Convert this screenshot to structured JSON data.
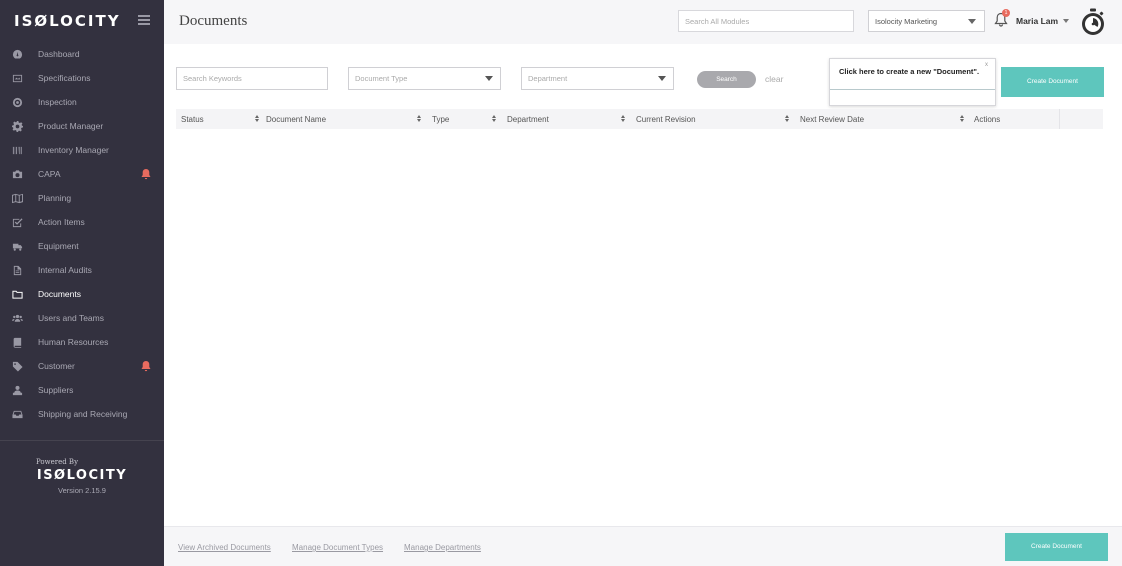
{
  "sidebar": {
    "logo_text": "ISØLOCITY",
    "items": [
      {
        "label": "Dashboard",
        "icon": "dashboard-icon"
      },
      {
        "label": "Specifications",
        "icon": "specifications-icon"
      },
      {
        "label": "Inspection",
        "icon": "inspection-icon"
      },
      {
        "label": "Product Manager",
        "icon": "gear-icon"
      },
      {
        "label": "Inventory Manager",
        "icon": "barcode-icon"
      },
      {
        "label": "CAPA",
        "icon": "camera-icon",
        "alert": true
      },
      {
        "label": "Planning",
        "icon": "map-icon"
      },
      {
        "label": "Action Items",
        "icon": "checkbox-icon"
      },
      {
        "label": "Equipment",
        "icon": "truck-icon"
      },
      {
        "label": "Internal Audits",
        "icon": "document-icon"
      },
      {
        "label": "Documents",
        "icon": "folder-icon",
        "active": true
      },
      {
        "label": "Users and Teams",
        "icon": "users-icon"
      },
      {
        "label": "Human Resources",
        "icon": "book-icon"
      },
      {
        "label": "Customer",
        "icon": "tag-icon",
        "alert": true
      },
      {
        "label": "Suppliers",
        "icon": "supplier-icon"
      },
      {
        "label": "Shipping and Receiving",
        "icon": "inbox-icon"
      }
    ],
    "powered_by": "Powered By",
    "brand": "ISØLOCITY",
    "version": "Version 2.15.9"
  },
  "header": {
    "title": "Documents",
    "global_search_placeholder": "Search All Modules",
    "company": "Isolocity Marketing",
    "notification_count": "1",
    "user_name": "Maria Lam"
  },
  "filters": {
    "keywords_placeholder": "Search Keywords",
    "document_type_placeholder": "Document Type",
    "department_placeholder": "Department",
    "search_label": "Search",
    "clear_label": "clear"
  },
  "tooltip": {
    "text": "Click here to create a new \"Document\".",
    "close": "x"
  },
  "create_label": "Create Document",
  "table": {
    "columns": [
      "Status",
      "Document Name",
      "Type",
      "Department",
      "Current Revision",
      "Next Review Date",
      "Actions"
    ]
  },
  "footer": {
    "links": [
      "View Archived Documents",
      "Manage Document Types",
      "Manage Departments"
    ],
    "create_label": "Create Document"
  },
  "colors": {
    "sidebar_bg": "#33313f",
    "accent": "#5ec6bd",
    "alert": "#e86b5f"
  }
}
